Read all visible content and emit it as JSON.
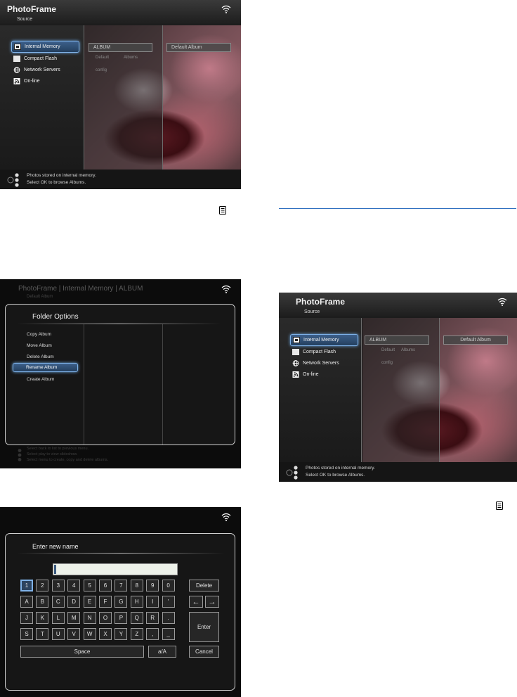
{
  "source_screen": {
    "app_title": "PhotoFrame",
    "subtitle": "Source",
    "menu": [
      {
        "label": "Internal Memory",
        "icon": "memory-icon",
        "selected": true
      },
      {
        "label": "Compact Flash",
        "icon": "card-icon",
        "selected": false
      },
      {
        "label": "Network Servers",
        "icon": "globe-icon",
        "selected": false
      },
      {
        "label": "On-line",
        "icon": "rss-icon",
        "selected": false
      }
    ],
    "album_label": "ALBUM",
    "sub_items": [
      "Default",
      "Albums",
      "config"
    ],
    "right_album": "Default Album",
    "status_line1": "Photos stored on internal memory.",
    "status_line2": "Select OK to browse Albums."
  },
  "folder_screen": {
    "header": "PhotoFrame | Internal Memory | ALBUM",
    "header_sub": "Default Album",
    "title": "Folder Options",
    "options": [
      "Copy Album",
      "Move Album",
      "Delete Album",
      "Rename Album",
      "Create Album"
    ],
    "selected_index": 3,
    "hint1": "Select back to list to previous menu.",
    "hint2": "Select play to view slideshow.",
    "hint3": "Select menu to create, copy and delete albums."
  },
  "keyboard_screen": {
    "title": "Enter new name",
    "input_value": "",
    "rows": [
      [
        "1",
        "2",
        "3",
        "4",
        "5",
        "6",
        "7",
        "8",
        "9",
        "0"
      ],
      [
        "A",
        "B",
        "C",
        "D",
        "E",
        "F",
        "G",
        "H",
        "I",
        "'"
      ],
      [
        "J",
        "K",
        "L",
        "M",
        "N",
        "O",
        "P",
        "Q",
        "R",
        "."
      ],
      [
        "S",
        "T",
        "U",
        "V",
        "W",
        "X",
        "Y",
        "Z",
        ",",
        "_"
      ]
    ],
    "delete_label": "Delete",
    "left_arrow": "←",
    "right_arrow": "→",
    "enter_label": "Enter",
    "space_label": "Space",
    "case_label": "a/A",
    "cancel_label": "Cancel"
  },
  "colors": {
    "highlight": "#7fb2e8",
    "rule": "#2f6fc0"
  }
}
